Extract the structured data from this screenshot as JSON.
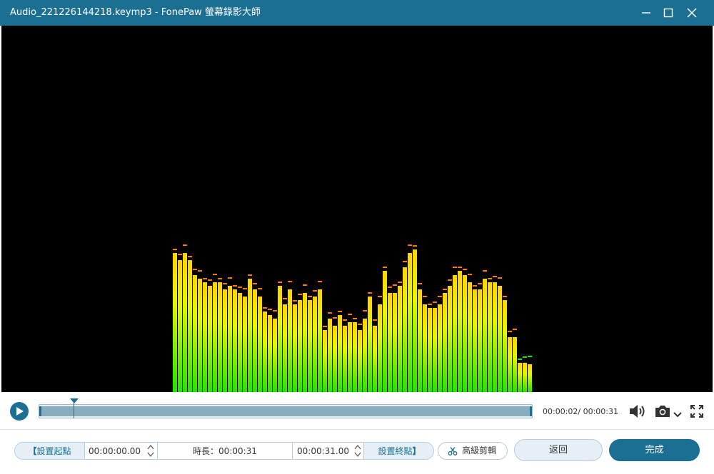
{
  "window": {
    "title": "Audio_221226144218.keymp3  -  FonePaw 螢幕錄影大師",
    "accent_color": "#1b6f92",
    "controls": {
      "minimize_icon": "minimize-icon",
      "maximize_icon": "maximize-icon",
      "close_icon": "close-icon"
    }
  },
  "player": {
    "time_display": "00:00:02/ 00:00:31",
    "progress_fraction": 0.07,
    "icons": [
      "play-icon",
      "volume-icon",
      "camera-icon",
      "chevron-down-icon",
      "fullscreen-icon"
    ]
  },
  "spectrum": {
    "bar_levels": [
      0.38,
      0.36,
      0.38,
      0.36,
      0.32,
      0.31,
      0.3,
      0.29,
      0.3,
      0.3,
      0.28,
      0.29,
      0.28,
      0.27,
      0.26,
      0.31,
      0.28,
      0.26,
      0.22,
      0.21,
      0.2,
      0.29,
      0.24,
      0.28,
      0.24,
      0.25,
      0.27,
      0.25,
      0.26,
      0.28,
      0.17,
      0.2,
      0.18,
      0.21,
      0.18,
      0.19,
      0.19,
      0.17,
      0.2,
      0.26,
      0.18,
      0.24,
      0.33,
      0.27,
      0.27,
      0.29,
      0.34,
      0.38,
      0.39,
      0.28,
      0.24,
      0.23,
      0.23,
      0.24,
      0.27,
      0.29,
      0.32,
      0.33,
      0.32,
      0.3,
      0.28,
      0.28,
      0.31,
      0.3,
      0.3,
      0.29,
      0.25,
      0.15,
      0.15,
      0.08,
      0.08,
      0.075
    ],
    "colors": {
      "top": "#ffd400",
      "mid": "#e8f600",
      "bottom": "#22e400",
      "peak": "#ff7a00"
    }
  },
  "editor": {
    "set_start_label": "設置起點",
    "start_time": "00:00:00.00",
    "duration_label": "時長：00:00:31",
    "end_time": "00:00:31.00",
    "set_end_label": "設置終點",
    "bracket_open": "【",
    "bracket_close": "】",
    "advanced_edit_label": "高級剪輯",
    "back_label": "返回",
    "done_label": "完成"
  }
}
